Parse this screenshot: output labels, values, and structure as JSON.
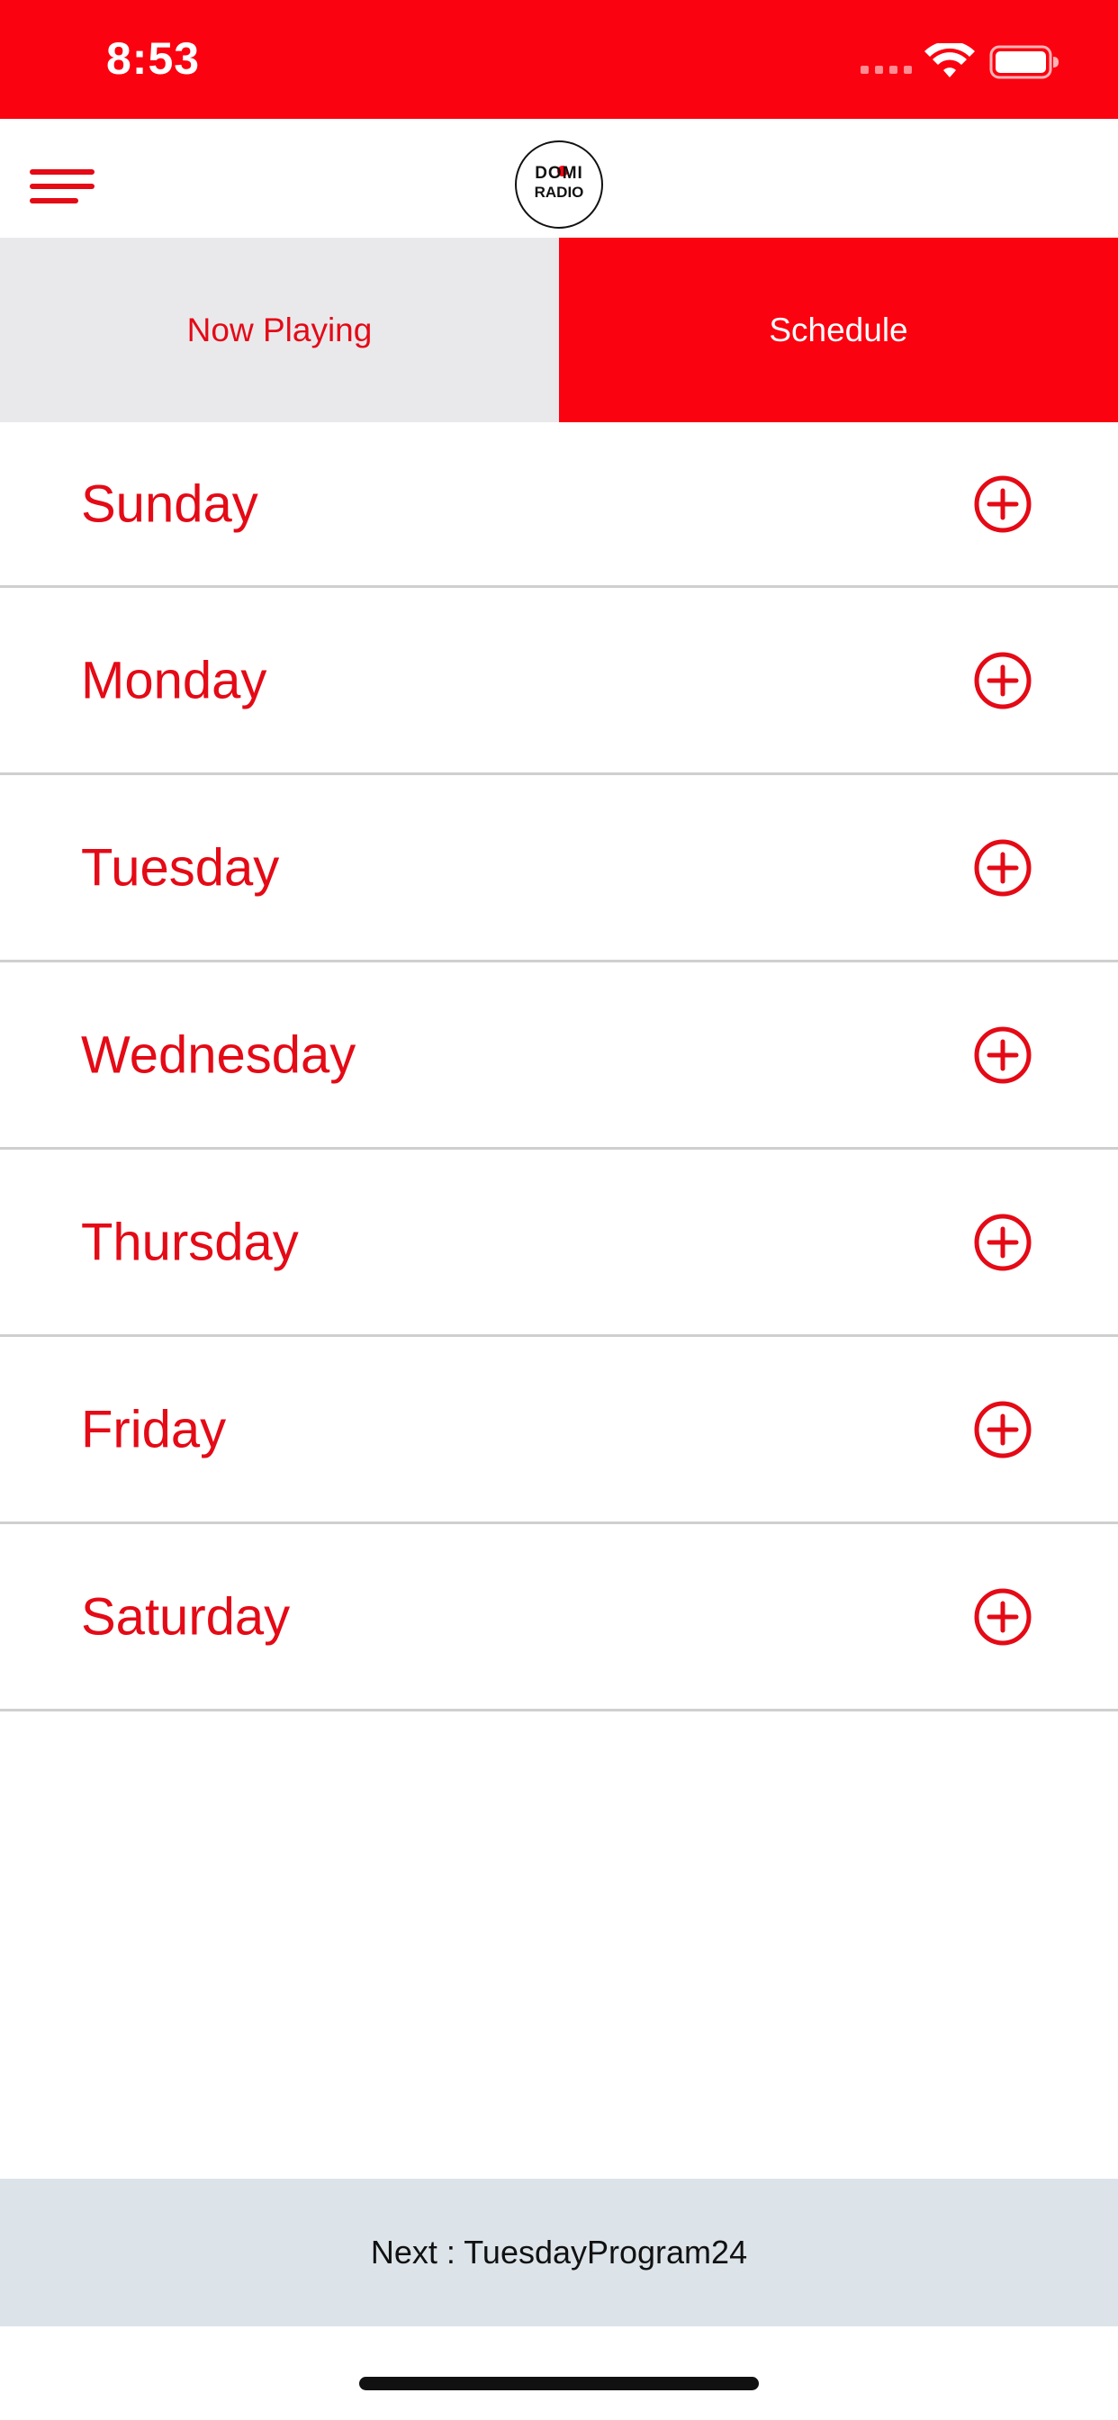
{
  "status_bar": {
    "time": "8:53",
    "signal_icon": "signal-dots-icon",
    "wifi_icon": "wifi-icon",
    "battery_icon": "battery-icon"
  },
  "header": {
    "menu_icon": "hamburger-menu-icon",
    "logo": {
      "line1": "DOMI",
      "line2": "RADIO"
    }
  },
  "tabs": [
    {
      "label": "Now Playing",
      "active": false
    },
    {
      "label": "Schedule",
      "active": true
    }
  ],
  "schedule": {
    "days": [
      {
        "label": "Sunday"
      },
      {
        "label": "Monday"
      },
      {
        "label": "Tuesday"
      },
      {
        "label": "Wednesday"
      },
      {
        "label": "Thursday"
      },
      {
        "label": "Friday"
      },
      {
        "label": "Saturday"
      }
    ],
    "expand_icon": "plus-circle-icon"
  },
  "footer": {
    "next_text": "Next : TuesdayProgram24"
  },
  "colors": {
    "brand_red": "#fb0210",
    "text_red": "#e40a16",
    "tab_inactive_bg": "#e9e9ec",
    "footer_bg": "#dce4ea",
    "divider": "#cfcfcf"
  }
}
